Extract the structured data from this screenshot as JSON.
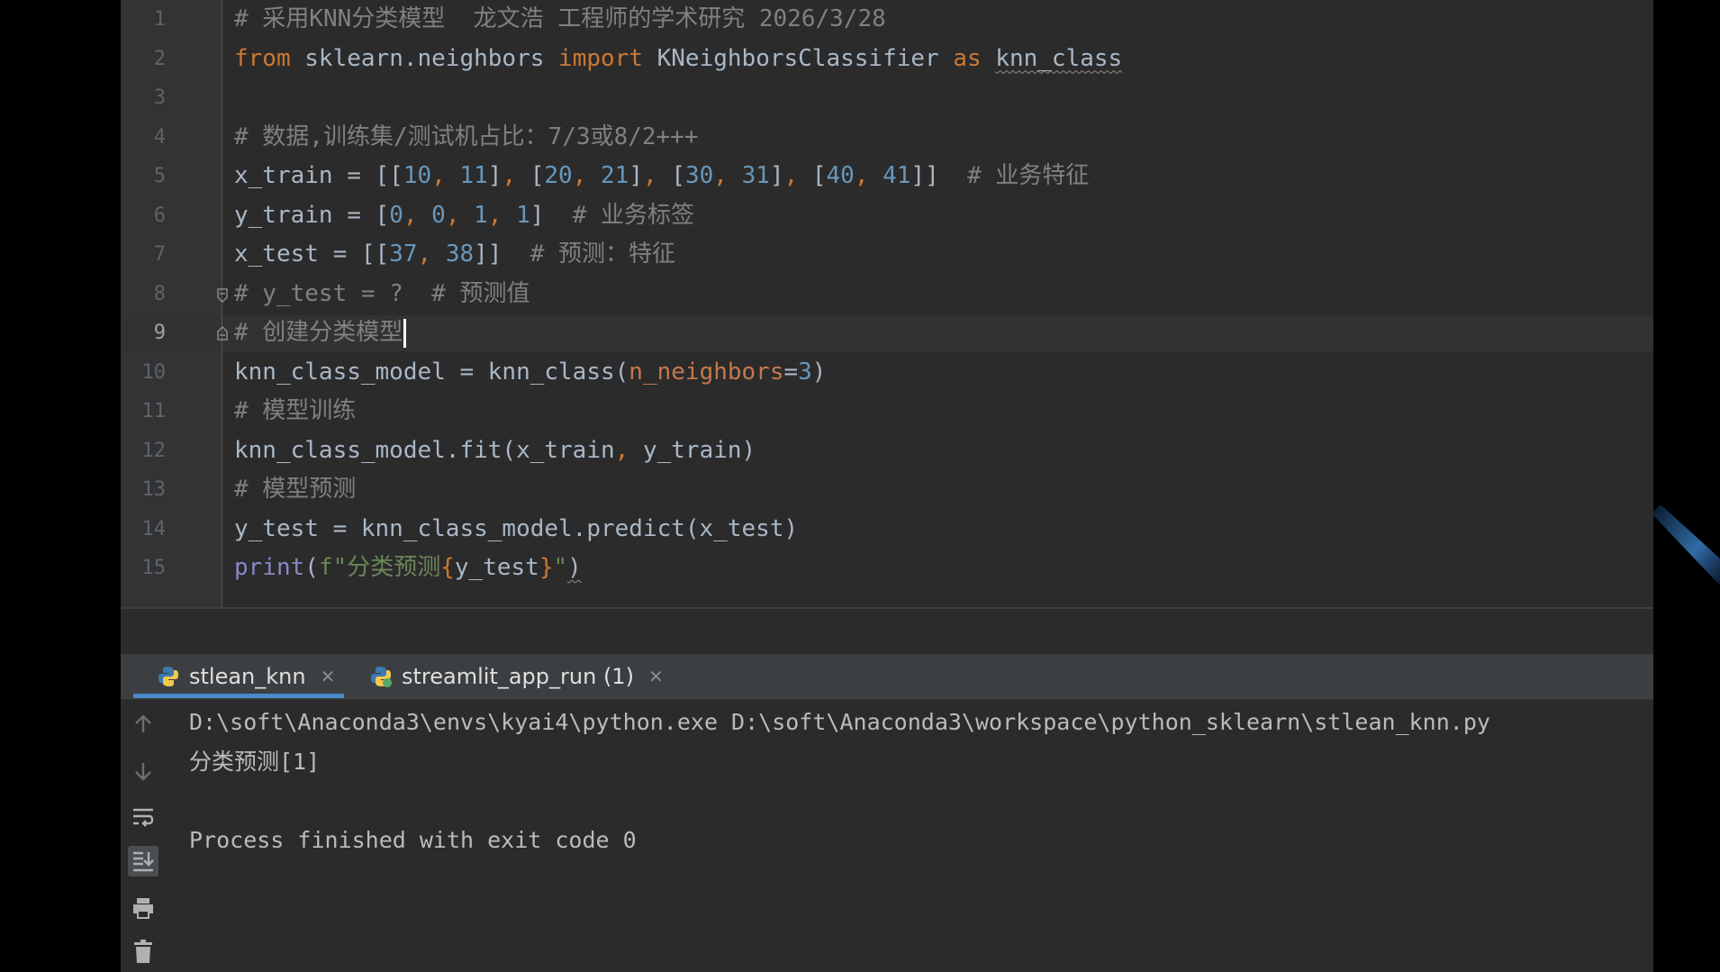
{
  "editor": {
    "current_line": "9",
    "line_numbers": [
      "1",
      "2",
      "3",
      "4",
      "5",
      "6",
      "7",
      "8",
      "9",
      "10",
      "11",
      "12",
      "13",
      "14",
      "15"
    ],
    "lines": [
      {
        "segments": [
          {
            "t": "# 采用KNN分类模型  龙文浩 工程师的学术研究 2026/3/28",
            "c": "cm"
          }
        ]
      },
      {
        "segments": [
          {
            "t": "from",
            "c": "kw"
          },
          {
            "t": " sklearn.neighbors "
          },
          {
            "t": "import",
            "c": "kw"
          },
          {
            "t": " KNeighborsClassifier "
          },
          {
            "t": "as",
            "c": "kw"
          },
          {
            "t": " "
          },
          {
            "t": "knn_class",
            "c": "squig"
          }
        ]
      },
      {
        "segments": []
      },
      {
        "segments": [
          {
            "t": "# 数据,训练集/测试机占比：7/3或8/2+++",
            "c": "cm"
          }
        ]
      },
      {
        "segments": [
          {
            "t": "x_train = [["
          },
          {
            "t": "10",
            "c": "num"
          },
          {
            "t": ", ",
            "c": "kw"
          },
          {
            "t": "11",
            "c": "num"
          },
          {
            "t": "]"
          },
          {
            "t": ", ",
            "c": "kw"
          },
          {
            "t": "["
          },
          {
            "t": "20",
            "c": "num"
          },
          {
            "t": ", ",
            "c": "kw"
          },
          {
            "t": "21",
            "c": "num"
          },
          {
            "t": "]"
          },
          {
            "t": ", ",
            "c": "kw"
          },
          {
            "t": "["
          },
          {
            "t": "30",
            "c": "num"
          },
          {
            "t": ", ",
            "c": "kw"
          },
          {
            "t": "31",
            "c": "num"
          },
          {
            "t": "]"
          },
          {
            "t": ", ",
            "c": "kw"
          },
          {
            "t": "["
          },
          {
            "t": "40",
            "c": "num"
          },
          {
            "t": ", ",
            "c": "kw"
          },
          {
            "t": "41",
            "c": "num"
          },
          {
            "t": "]]  "
          },
          {
            "t": "# 业务特征",
            "c": "cm"
          }
        ]
      },
      {
        "segments": [
          {
            "t": "y_train = ["
          },
          {
            "t": "0",
            "c": "num"
          },
          {
            "t": ", ",
            "c": "kw"
          },
          {
            "t": "0",
            "c": "num"
          },
          {
            "t": ", ",
            "c": "kw"
          },
          {
            "t": "1",
            "c": "num"
          },
          {
            "t": ", ",
            "c": "kw"
          },
          {
            "t": "1",
            "c": "num"
          },
          {
            "t": "]  "
          },
          {
            "t": "# 业务标签",
            "c": "cm"
          }
        ]
      },
      {
        "segments": [
          {
            "t": "x_test = [["
          },
          {
            "t": "37",
            "c": "num"
          },
          {
            "t": ", ",
            "c": "kw"
          },
          {
            "t": "38",
            "c": "num"
          },
          {
            "t": "]]  "
          },
          {
            "t": "# 预测：特征",
            "c": "cm"
          }
        ]
      },
      {
        "segments": [
          {
            "t": "# y_test = ?  # 预测值",
            "c": "cm"
          }
        ]
      },
      {
        "segments": [
          {
            "t": "# 创建分类模型",
            "c": "cm"
          }
        ],
        "caret": true
      },
      {
        "segments": [
          {
            "t": "knn_class_model = knn_class("
          },
          {
            "t": "n_neighbors",
            "c": "param"
          },
          {
            "t": "="
          },
          {
            "t": "3",
            "c": "num"
          },
          {
            "t": ")"
          }
        ]
      },
      {
        "segments": [
          {
            "t": "# 模型训练",
            "c": "cm"
          }
        ]
      },
      {
        "segments": [
          {
            "t": "knn_class_model.fit(x_train"
          },
          {
            "t": ", ",
            "c": "kw"
          },
          {
            "t": "y_train)"
          }
        ]
      },
      {
        "segments": [
          {
            "t": "# 模型预测",
            "c": "cm"
          }
        ]
      },
      {
        "segments": [
          {
            "t": "y_test = knn_class_model.predict(x_test)"
          }
        ]
      },
      {
        "segments": [
          {
            "t": "print",
            "c": "bi"
          },
          {
            "t": "("
          },
          {
            "t": "f\"分类预测",
            "c": "str"
          },
          {
            "t": "{",
            "c": "kw"
          },
          {
            "t": "y_test"
          },
          {
            "t": "}",
            "c": "kw"
          },
          {
            "t": "\"",
            "c": "str"
          },
          {
            "t": ")",
            "c": "squig"
          }
        ]
      }
    ]
  },
  "run_panel": {
    "tabs": [
      {
        "label": "stlean_knn",
        "icon": "python-icon",
        "active": true
      },
      {
        "label": "streamlit_app_run (1)",
        "icon": "python-icon",
        "active": false
      }
    ],
    "console_lines": [
      "D:\\soft\\Anaconda3\\envs\\kyai4\\python.exe D:\\soft\\Anaconda3\\workspace\\python_sklearn\\stlean_knn.py",
      "分类预测[1]",
      "",
      "Process finished with exit code 0"
    ],
    "toolbar": [
      "arrow-up-icon",
      "arrow-down-icon",
      "soft-wrap-icon",
      "scroll-to-end-icon",
      "print-icon",
      "trash-icon"
    ]
  },
  "colors": {
    "editor_bg": "#2b2b2b",
    "keyword": "#cc7832",
    "number": "#6897bb",
    "comment": "#808080",
    "string": "#6a8759",
    "param": "#c4784d",
    "tab_accent": "#4a88c7"
  }
}
